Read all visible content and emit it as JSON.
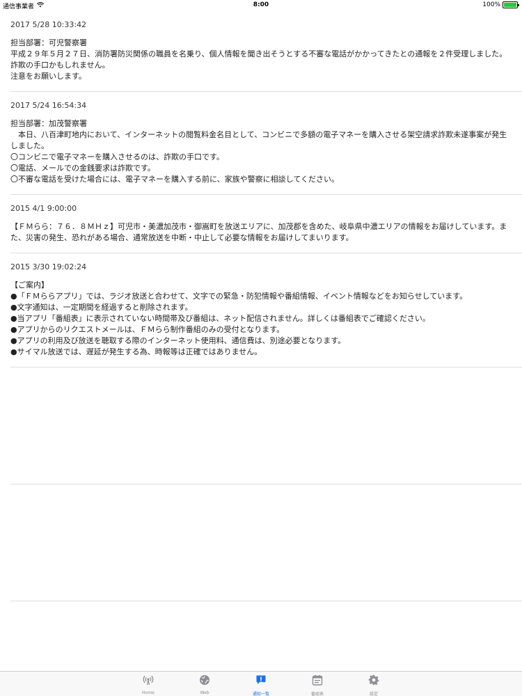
{
  "status_bar": {
    "carrier": "通信事業者",
    "time": "8:00",
    "battery": "100%",
    "battery_level": 1.0
  },
  "notices": [
    {
      "date": "2017 5/28 10:33:42",
      "body": "担当部署：可児警察署\n平成２９年５月２７日、消防署防災関係の職員を名乗り、個人情報を聞き出そうとする不審な電話がかかってきたとの通報を２件受理しました。\n詐欺の手口かもしれません。\n注意をお願いします。"
    },
    {
      "date": "2017 5/24 16:54:34",
      "body": "担当部署：加茂警察署\n　本日、八百津町地内において、インターネットの閲覧料金名目として、コンビニで多額の電子マネーを購入させる架空請求詐欺未遂事案が発生しました。\n〇コンビニで電子マネーを購入させるのは、詐欺の手口です。\n〇電話、メールでの金銭要求は詐欺です。\n〇不審な電話を受けた場合には、電子マネーを購入する前に、家族や警察に相談してください。"
    },
    {
      "date": "2015 4/1 9:00:00",
      "body": "【ＦＭらら：７６．８ＭＨｚ】可児市・美濃加茂市・御嵩町を放送エリアに、加茂郡を含めた、岐阜県中濃エリアの情報をお届けしています。また、災害の発生、恐れがある場合、通常放送を中断・中止して必要な情報をお届けしてまいります。"
    },
    {
      "date": "2015 3/30 19:02:24",
      "body": "【ご案内】\n●「ＦＭららアプリ」では、ラジオ放送と合わせて、文字での緊急・防犯情報や番組情報、イベント情報などをお知らせしています。\n●文字通知は、一定期間を経過すると削除されます。\n●当アプリ「番組表」に表示されていない時間帯及び番組は、ネット配信されません。詳しくは番組表でご確認ください。\n●アプリからのリクエストメールは、ＦＭらら制作番組のみの受付となります。\n●アプリの利用及び放送を聴取する際のインターネット使用料、通信費は、別途必要となります。\n●サイマル放送では、遅延が発生する為、時報等は正確ではありません。"
    }
  ],
  "tab_bar": {
    "tabs": [
      {
        "label": "Home",
        "icon": "radio-antenna-icon"
      },
      {
        "label": "Web",
        "icon": "globe-icon"
      },
      {
        "label": "通知一覧",
        "icon": "notice-icon"
      },
      {
        "label": "番組表",
        "icon": "calendar-icon"
      },
      {
        "label": "設定",
        "icon": "gear-icon"
      }
    ],
    "active_index": 2,
    "active_color": "#1e6ff0",
    "inactive_color": "#8e8e93"
  }
}
